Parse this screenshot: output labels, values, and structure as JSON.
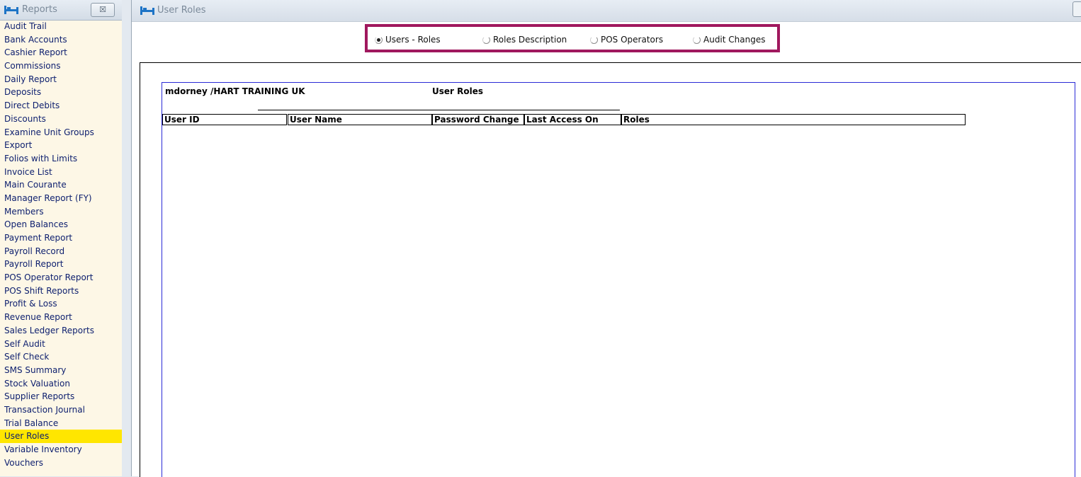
{
  "sidebar": {
    "title": "Reports",
    "close_label": "☒",
    "items": [
      "Audit Trail",
      "Bank Accounts",
      "Cashier Report",
      "Commissions",
      "Daily Report",
      "Deposits",
      "Direct Debits",
      "Discounts",
      "Examine Unit Groups",
      "Export",
      "Folios with Limits",
      "Invoice List",
      "Main Courante",
      "Manager Report (FY)",
      "Members",
      "Open Balances",
      "Payment Report",
      "Payroll Record",
      "Payroll Report",
      "POS Operator Report",
      "POS Shift Reports",
      "Profit & Loss",
      "Revenue Report",
      "Sales Ledger Reports",
      "Self Audit",
      "Self Check",
      "SMS Summary",
      "Stock Valuation",
      "Supplier Reports",
      "Transaction Journal",
      "Trial Balance",
      "User Roles",
      "Variable Inventory",
      "Vouchers"
    ],
    "active_item": "User Roles"
  },
  "window": {
    "title": "User Roles"
  },
  "options": [
    {
      "label": "Users - Roles",
      "checked": true
    },
    {
      "label": "Roles Description",
      "checked": false
    },
    {
      "label": "POS Operators",
      "checked": false
    },
    {
      "label": "Audit Changes",
      "checked": false
    }
  ],
  "report": {
    "user_line": "mdorney /HART TRAINING UK",
    "title": "User Roles",
    "columns": [
      "User ID",
      "User Name",
      "Password Change",
      "Last Access On",
      "Roles"
    ]
  },
  "colors": {
    "highlight_border": "#a0185e",
    "active_item_bg": "#ffe600",
    "report_border": "#2b2bd6"
  },
  "icons": {
    "header_icon": "bed-icon"
  }
}
